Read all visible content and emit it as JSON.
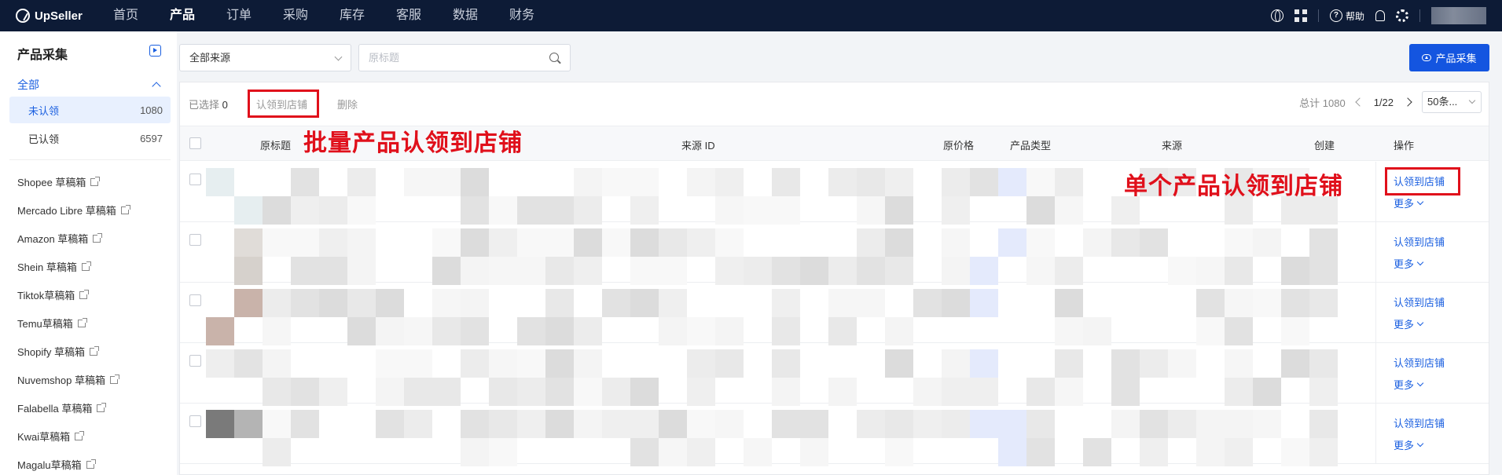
{
  "app": {
    "logo_text": "UpSeller"
  },
  "nav": {
    "items": [
      "首页",
      "产品",
      "订单",
      "采购",
      "库存",
      "客服",
      "数据",
      "财务"
    ],
    "active_index": 1,
    "help_label": "帮助"
  },
  "sidebar": {
    "title": "产品采集",
    "group_label": "全部",
    "sub_items": [
      {
        "label": "未认领",
        "count": "1080",
        "active": true
      },
      {
        "label": "已认领",
        "count": "6597",
        "active": false
      }
    ],
    "links": [
      "Shopee 草稿箱",
      "Mercado Libre 草稿箱",
      "Amazon 草稿箱",
      "Shein 草稿箱",
      "Tiktok草稿箱",
      "Temu草稿箱",
      "Shopify 草稿箱",
      "Nuvemshop 草稿箱",
      "Falabella 草稿箱",
      "Kwai草稿箱",
      "Magalu草稿箱"
    ]
  },
  "filters": {
    "source_select": "全部来源",
    "search_placeholder": "原标题"
  },
  "actions": {
    "collect_button": "产品采集"
  },
  "toolbar": {
    "selected_label": "已选择",
    "selected_count": "0",
    "claim_button": "认领到店铺",
    "delete_button": "删除"
  },
  "pagination": {
    "total": "总计 1080",
    "page": "1/22",
    "page_size": "50条..."
  },
  "table": {
    "headers": [
      "原标题",
      "来源 ID",
      "原价格",
      "产品类型",
      "来源",
      "创建",
      "操作"
    ],
    "row_actions": {
      "claim": "认领到店铺",
      "more": "更多"
    },
    "row_count": 5
  },
  "annotations": {
    "batch": "批量产品认领到店铺",
    "single": "单个产品认领到店铺",
    "highlight_color": "#e0101b"
  },
  "colors": {
    "topbar": "#0d1b36",
    "primary": "#1455e0",
    "link": "#1a5fe0"
  }
}
